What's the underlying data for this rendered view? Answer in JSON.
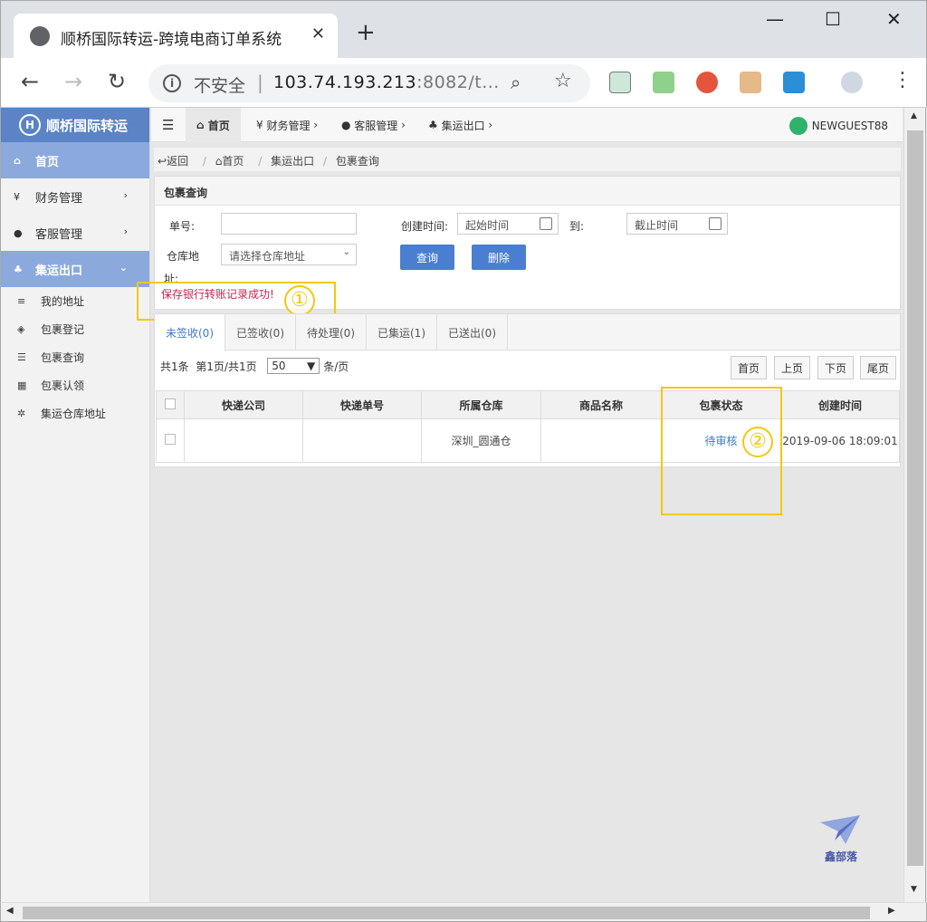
{
  "browser": {
    "tab_title": "顺桥国际转运-跨境电商订单系统",
    "tab_close": "✕",
    "new_tab": "+",
    "insecure_label": "不安全",
    "url_host": "103.74.193.213",
    "url_rest": ":8082/t...",
    "win_min": "—",
    "win_max": "☐",
    "win_close": "✕"
  },
  "sidebar": {
    "logo": "顺桥国际转运",
    "items": [
      {
        "icon": "home-icon",
        "label": "首页"
      },
      {
        "icon": "yen-icon",
        "label": "财务管理"
      },
      {
        "icon": "user-icon",
        "label": "客服管理"
      },
      {
        "icon": "cubes-icon",
        "label": "集运出口"
      }
    ],
    "subitems": [
      {
        "icon": "list-icon",
        "label": "我的地址"
      },
      {
        "icon": "box-icon",
        "label": "包裹登记"
      },
      {
        "icon": "list-alt-icon",
        "label": "包裹查询"
      },
      {
        "icon": "grid-icon",
        "label": "包裹认领"
      },
      {
        "icon": "gear-icon",
        "label": "集运仓库地址"
      }
    ]
  },
  "topnav": {
    "menus": [
      "首页",
      "财务管理",
      "客服管理",
      "集运出口"
    ],
    "user": "NEWGUEST88"
  },
  "breadcrumb": [
    "返回",
    "首页",
    "集运出口",
    "包裹查询"
  ],
  "search": {
    "title": "包裹查询",
    "order_label": "单号:",
    "created_label": "创建时间:",
    "start_placeholder": "起始时间",
    "to_label": "到:",
    "end_placeholder": "截止时间",
    "warehouse_label": "仓库地",
    "warehouse_label2": "址:",
    "warehouse_select": "请选择仓库地址",
    "query_btn": "查询",
    "delete_btn": "删除",
    "success_msg": "保存银行转账记录成功!"
  },
  "annotations": {
    "one": "①",
    "two": "②"
  },
  "tabs": [
    "未签收(0)",
    "已签收(0)",
    "待处理(0)",
    "已集运(1)",
    "已送出(0)"
  ],
  "pager": {
    "total": "共1条",
    "page": "第1页/共1页",
    "size": "50",
    "per": "条/页",
    "first": "首页",
    "prev": "上页",
    "next": "下页",
    "last": "尾页"
  },
  "table": {
    "headers": [
      "快递公司",
      "快递单号",
      "所属仓库",
      "商品名称",
      "包裹状态",
      "创建时间"
    ],
    "rows": [
      {
        "courier": "",
        "tracking": "",
        "warehouse": "深圳_圆通仓",
        "product": "",
        "status": "待审核",
        "created": "2019-09-06 18:09:01"
      }
    ]
  },
  "watermark": "鑫部落",
  "colors": {
    "accent": "#4a7ed0",
    "sidebar_active": "#8ba9dc",
    "highlight": "#f2c811",
    "success": "#c7254e"
  }
}
